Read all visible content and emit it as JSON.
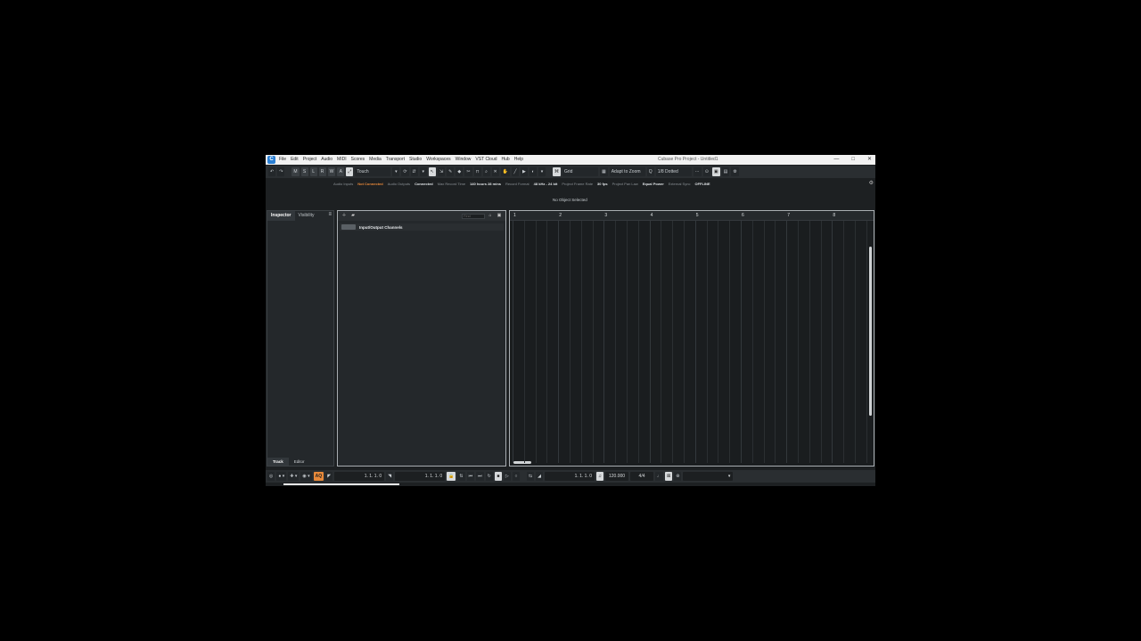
{
  "title_bar": {
    "logo": "C",
    "menu": [
      "File",
      "Edit",
      "Project",
      "Audio",
      "MIDI",
      "Scores",
      "Media",
      "Transport",
      "Studio",
      "Workspaces",
      "Window",
      "VST Cloud",
      "Hub",
      "Help"
    ],
    "app_title": "Cubase Pro Project - Untitled1",
    "controls": [
      "—",
      "□",
      "✕"
    ]
  },
  "toolbar": {
    "undo": "↶",
    "redo": "↷",
    "track_buttons": [
      "M",
      "S",
      "L",
      "R",
      "W",
      "A"
    ],
    "automation_mode": "Touch",
    "snap_type": "Grid",
    "grid_mode": "Adapt to Zoom",
    "quantize": "1/8 Dotted"
  },
  "status_line": {
    "items": [
      {
        "label": "Audio Inputs",
        "value": "Not Connected",
        "accent": "#e8893a"
      },
      {
        "label": "Audio Outputs",
        "value": "Connected"
      },
      {
        "label": "Max Record Time",
        "value": "140 hours 28 mins"
      },
      {
        "label": "Record Format",
        "value": "48 kHz - 24 bit"
      },
      {
        "label": "Project Frame Rate",
        "value": "30 fps"
      },
      {
        "label": "Project Pan Law",
        "value": "Equal Power"
      },
      {
        "label": "External Sync",
        "value": "OFFLINE"
      }
    ]
  },
  "info_line": {
    "message": "No Object Selected"
  },
  "inspector": {
    "tabs": [
      "Inspector",
      "Visibility"
    ],
    "menu_icon": "≡",
    "bottom_tabs": [
      "Track",
      "Editor"
    ]
  },
  "track_list": {
    "find_placeholder": "Find",
    "tracks": [
      {
        "name": "Input/Output Channels"
      }
    ]
  },
  "ruler": {
    "bars": [
      "1",
      "2",
      "3",
      "4",
      "5",
      "6",
      "7",
      "8"
    ]
  },
  "transport": {
    "aq_label": "AQ",
    "left_locator": "1. 1. 1.   0",
    "right_locator": "1. 1. 1.   0",
    "primary_time": "1. 1. 1.   0",
    "tempo": "120.000",
    "signature": "4/4"
  },
  "colors": {
    "accent": "#e8893a",
    "background": "#1d2022"
  }
}
